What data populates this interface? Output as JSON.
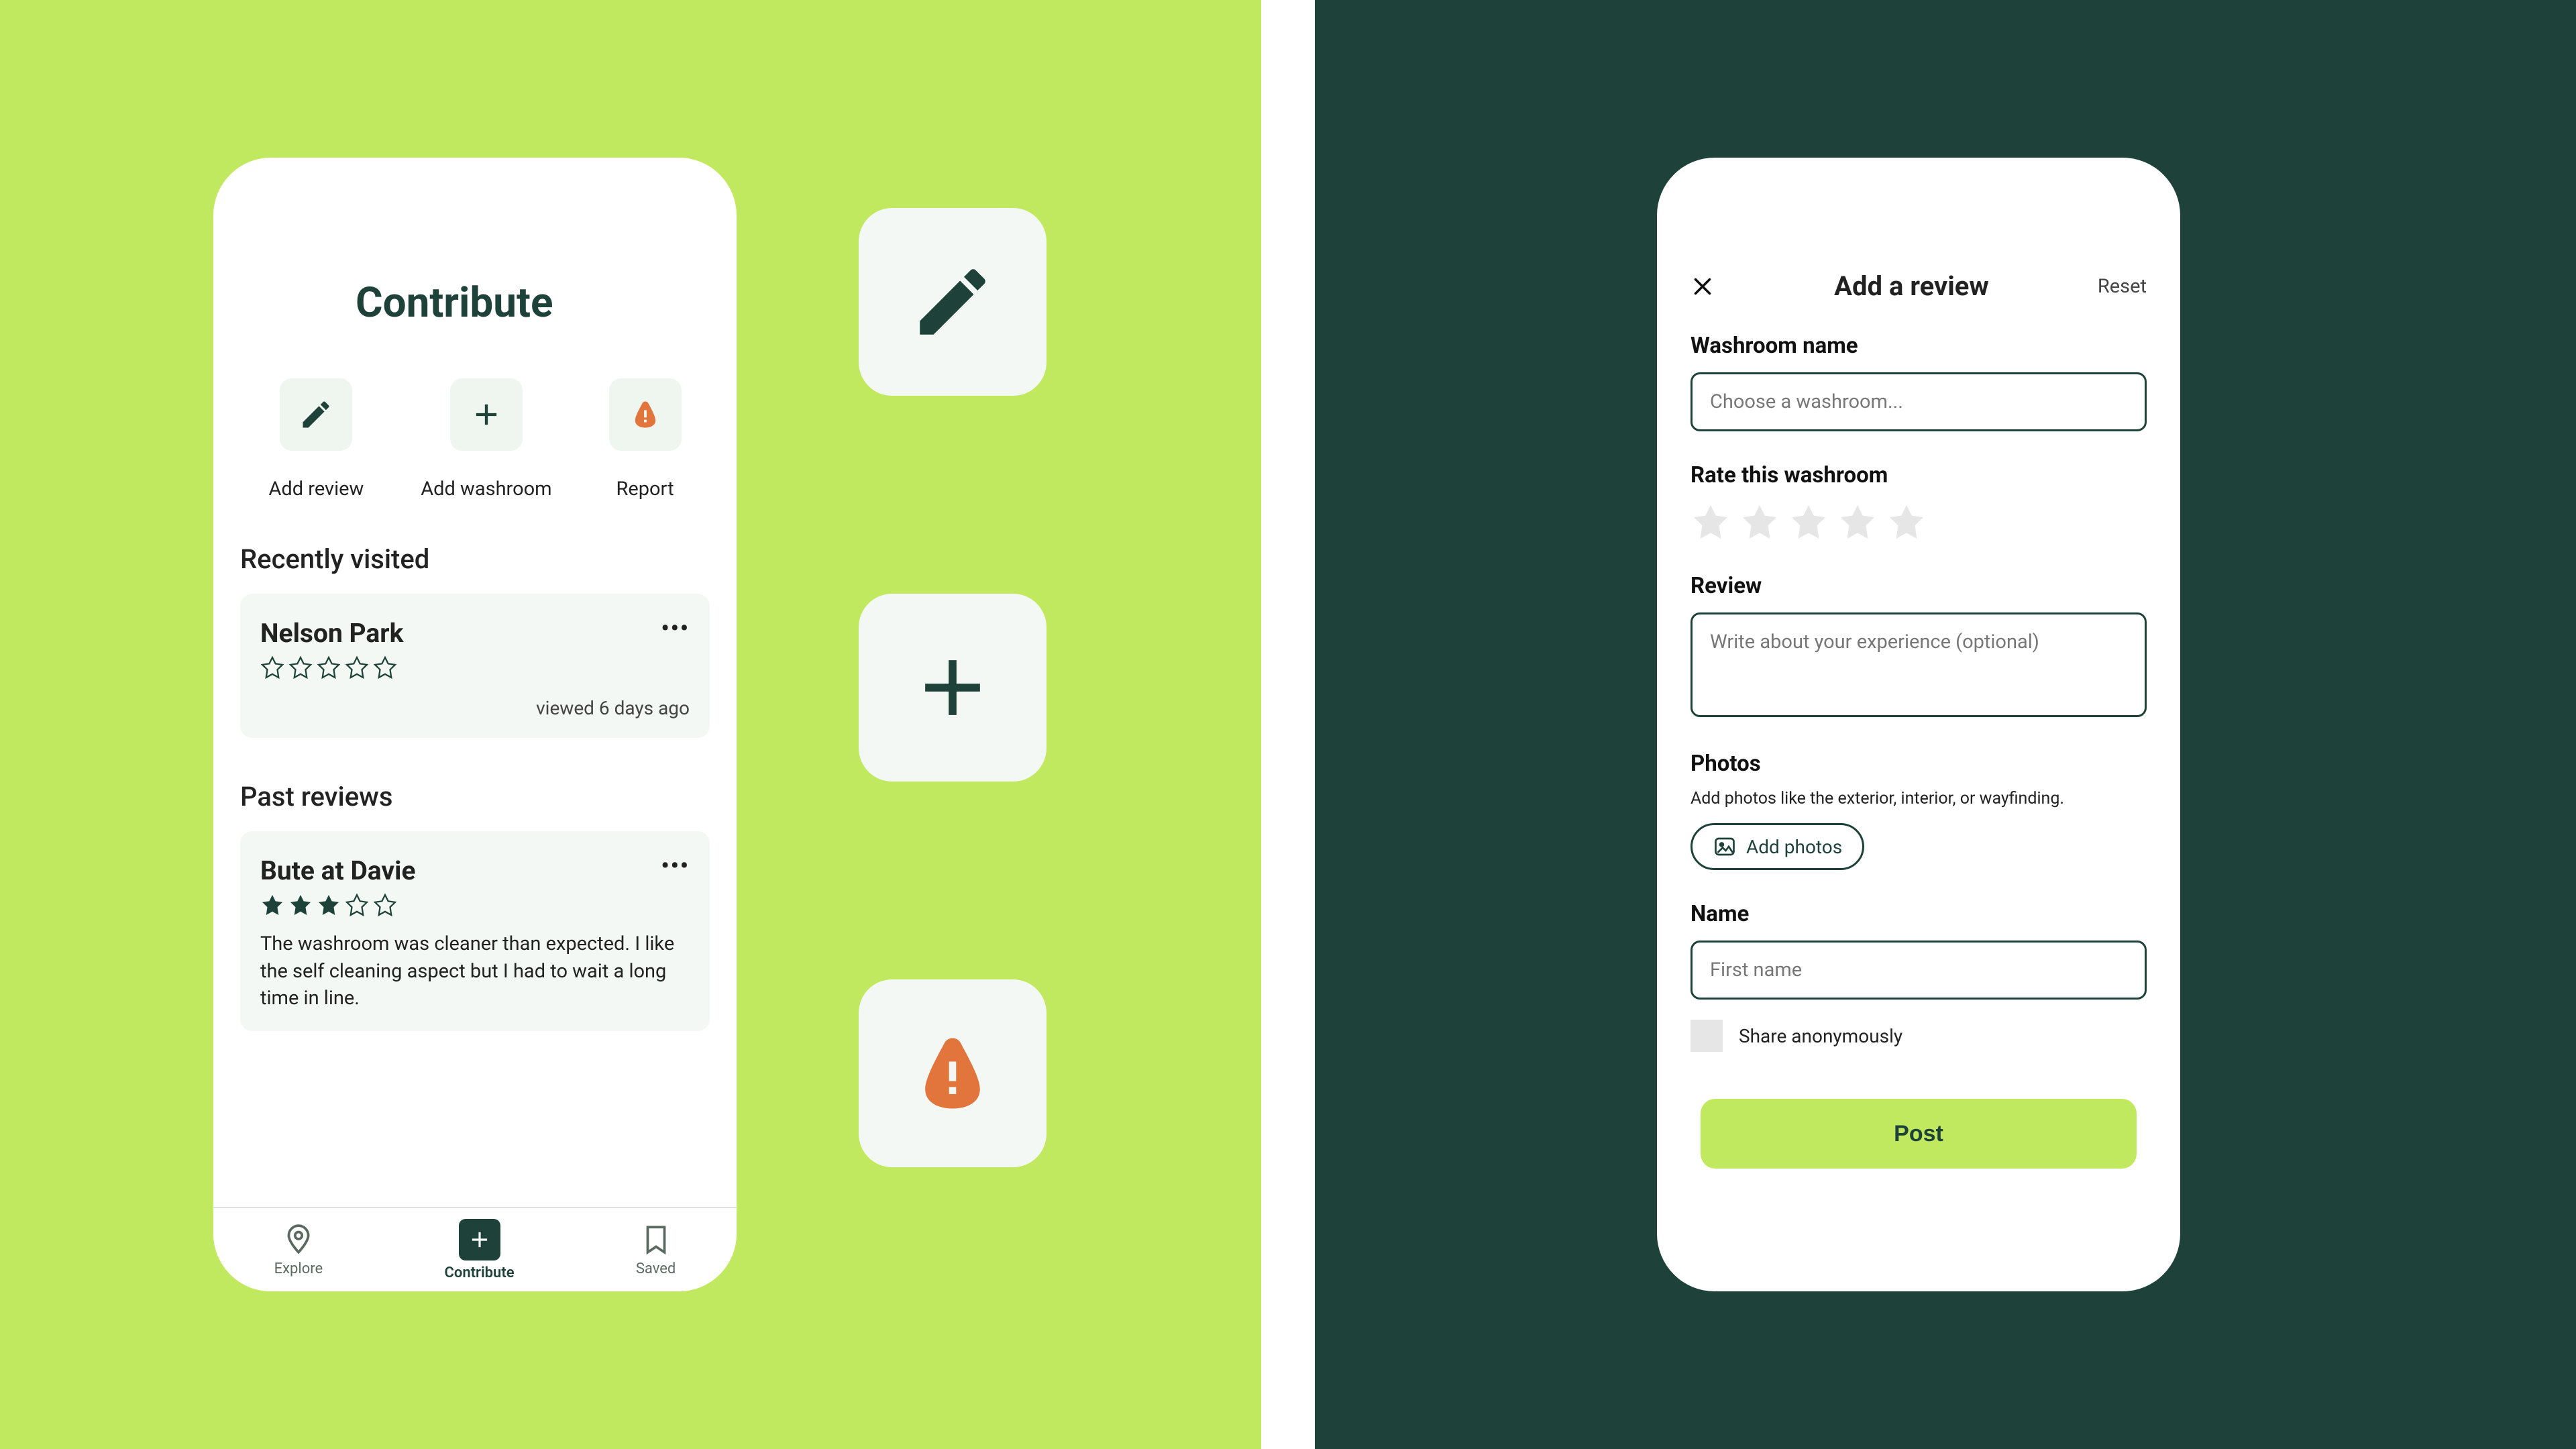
{
  "colors": {
    "lime": "#c1e95f",
    "darkGreen": "#1e423a",
    "orange": "#e2753c",
    "cardBg": "#f3f8f4"
  },
  "left": {
    "title": "Contribute",
    "actions": [
      {
        "icon": "pencil",
        "label": "Add review"
      },
      {
        "icon": "plus",
        "label": "Add washroom"
      },
      {
        "icon": "report",
        "label": "Report"
      }
    ],
    "recentlyVisited": {
      "heading": "Recently visited",
      "item": {
        "name": "Nelson Park",
        "stars_filled": 0,
        "timestamp": "viewed 6 days ago"
      }
    },
    "pastReviews": {
      "heading": "Past reviews",
      "item": {
        "name": "Bute at Davie",
        "stars_filled": 3,
        "text": "The washroom was cleaner than expected. I like the self cleaning aspect but I had to wait a long time in line."
      }
    },
    "tabs": {
      "explore": "Explore",
      "contribute": "Contribute",
      "saved": "Saved"
    }
  },
  "right": {
    "title": "Add a review",
    "reset": "Reset",
    "fields": {
      "washroom": {
        "label": "Washroom name",
        "placeholder": "Choose a washroom..."
      },
      "rate": {
        "label": "Rate this washroom"
      },
      "review": {
        "label": "Review",
        "placeholder": "Write about your experience (optional)"
      },
      "photos": {
        "label": "Photos",
        "sub": "Add photos like the exterior, interior, or wayfinding.",
        "button": "Add photos"
      },
      "name": {
        "label": "Name",
        "placeholder": "First name"
      },
      "anon": {
        "label": "Share anonymously"
      }
    },
    "post": "Post"
  }
}
